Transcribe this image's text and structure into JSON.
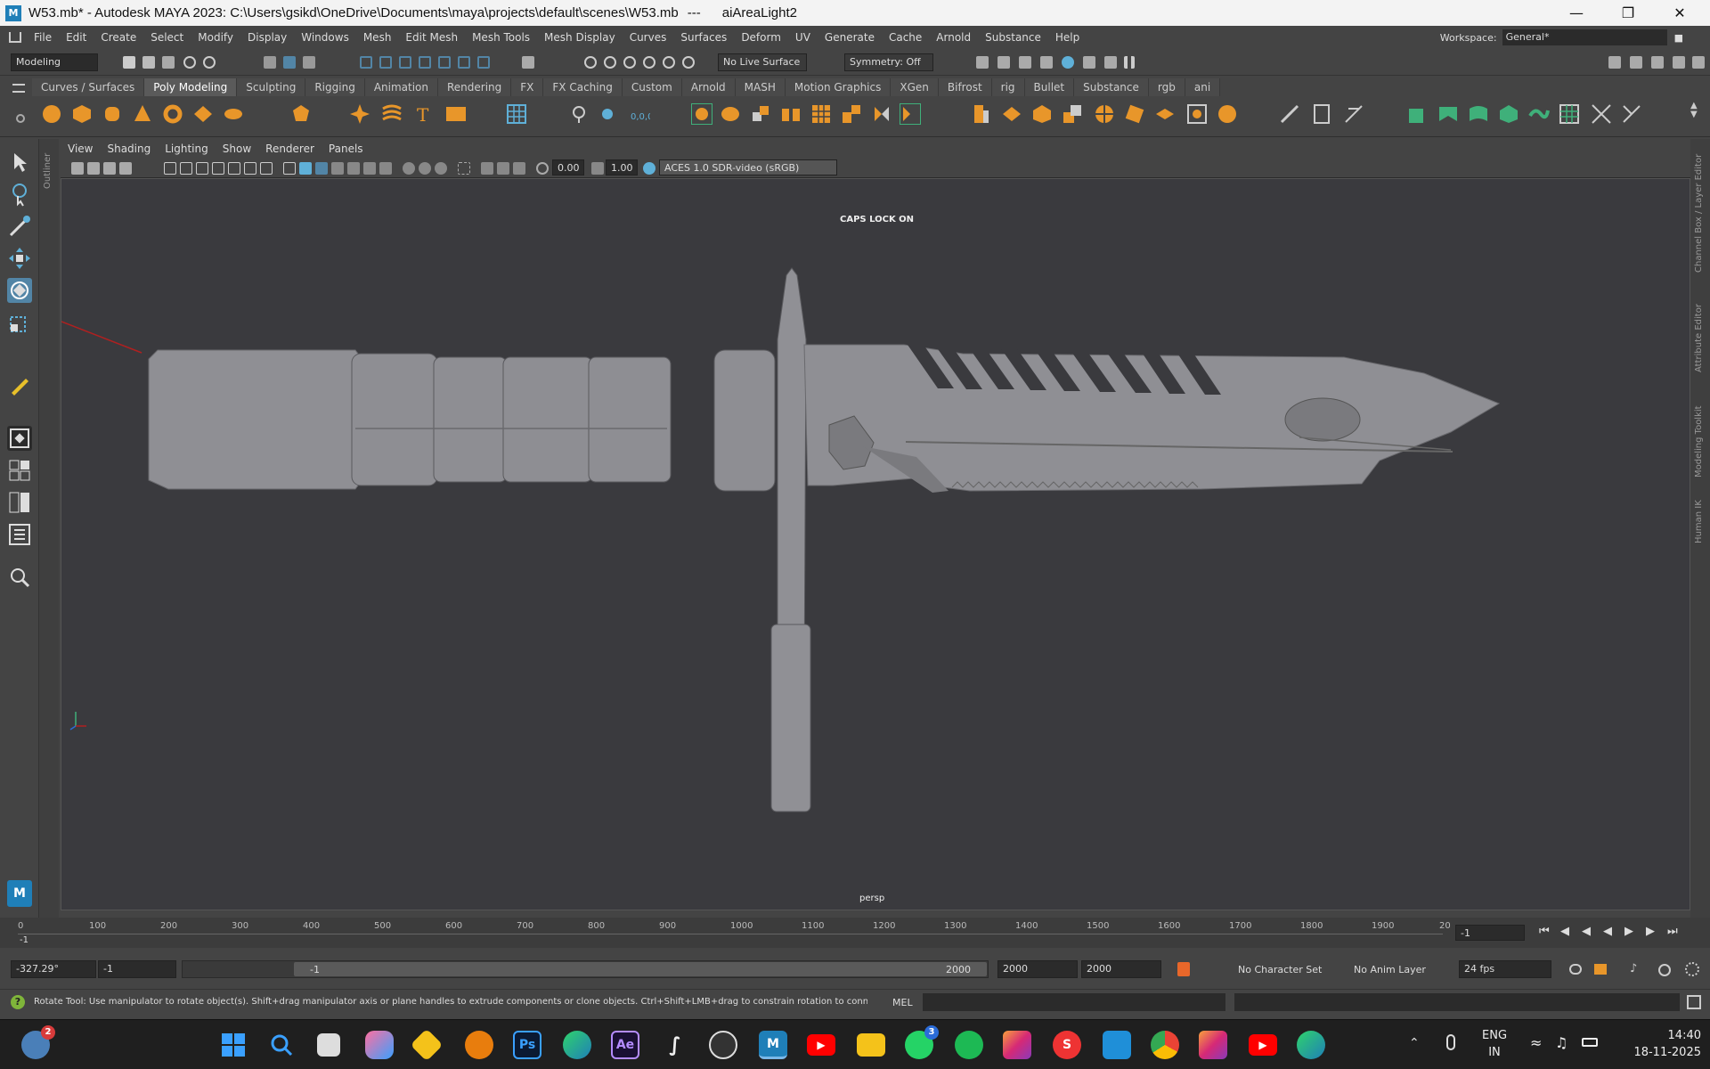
{
  "window": {
    "title": "W53.mb* - Autodesk MAYA 2023: C:\\Users\\gsikd\\OneDrive\\Documents\\maya\\projects\\default\\scenes\\W53.mb",
    "separator": "---",
    "selected_object": "aiAreaLight2",
    "minimize_icon": "minimize-icon",
    "maximize_icon": "restore-icon",
    "close_icon": "close-icon"
  },
  "menubar": {
    "items": [
      "File",
      "Edit",
      "Create",
      "Select",
      "Modify",
      "Display",
      "Windows",
      "Mesh",
      "Edit Mesh",
      "Mesh Tools",
      "Mesh Display",
      "Curves",
      "Surfaces",
      "Deform",
      "UV",
      "Generate",
      "Cache",
      "Arnold",
      "Substance",
      "Help"
    ],
    "workspace_label": "Workspace:",
    "workspace_value": "General*"
  },
  "statusline": {
    "mode": "Modeling",
    "live_surface": "No Live Surface",
    "symmetry": "Symmetry: Off"
  },
  "shelf": {
    "tabs": [
      "Curves / Surfaces",
      "Poly Modeling",
      "Sculpting",
      "Rigging",
      "Animation",
      "Rendering",
      "FX",
      "FX Caching",
      "Custom",
      "Arnold",
      "MASH",
      "Motion Graphics",
      "XGen",
      "Bifrost",
      "rig",
      "Bullet",
      "Substance",
      "rgb",
      "ani"
    ],
    "active_tab": "Poly Modeling"
  },
  "panel": {
    "menus": [
      "View",
      "Shading",
      "Lighting",
      "Show",
      "Renderer",
      "Panels"
    ],
    "exposure": "0.00",
    "gamma": "1.00",
    "colorspace": "ACES 1.0 SDR-video (sRGB)"
  },
  "viewport": {
    "hud_message": "CAPS LOCK ON",
    "camera": "persp"
  },
  "side_labels": {
    "outliner": "Outliner",
    "channel_box": "Channel Box / Layer Editor",
    "attribute_editor": "Attribute Editor",
    "modeling_toolkit": "Modeling Toolkit",
    "human_ik": "Human IK"
  },
  "timeline": {
    "ticks": [
      "0",
      "100",
      "200",
      "300",
      "400",
      "500",
      "600",
      "700",
      "800",
      "900",
      "1000",
      "1100",
      "1200",
      "1300",
      "1400",
      "1500",
      "1600",
      "1700",
      "1800",
      "1900",
      "20"
    ],
    "current_frame_marker": "-1",
    "current_frame": "-1"
  },
  "range": {
    "rotation_value": "-327.29°",
    "start": "-1",
    "slider_start": "-1",
    "slider_end": "2000",
    "end": "2000",
    "end2": "2000",
    "character_set": "No Character Set",
    "anim_layer": "No Anim Layer",
    "fps": "24 fps"
  },
  "cmdline": {
    "help_text": "Rotate Tool: Use manipulator to rotate object(s). Shift+drag manipulator axis or plane handles to extrude components or clone objects. Ctrl+Shift+LMB+drag to constrain rotation to connected edges. Use D or INSE",
    "language": "MEL"
  },
  "taskbar": {
    "weather_badge": "2",
    "whatsapp_badge": "3",
    "ps_label": "Ps",
    "ae_label": "Ae",
    "maya_label": "M",
    "language": "ENG",
    "region": "IN",
    "time": "14:40",
    "date": "18-11-2025"
  },
  "colors": {
    "maya_bg": "#444444",
    "viewport_bg": "#3a3a3e",
    "knife_gray": "#8f8f94",
    "accent_blue": "#5285a6",
    "shelf_orange": "#e8962a",
    "shelf_green": "#3fb07a"
  }
}
